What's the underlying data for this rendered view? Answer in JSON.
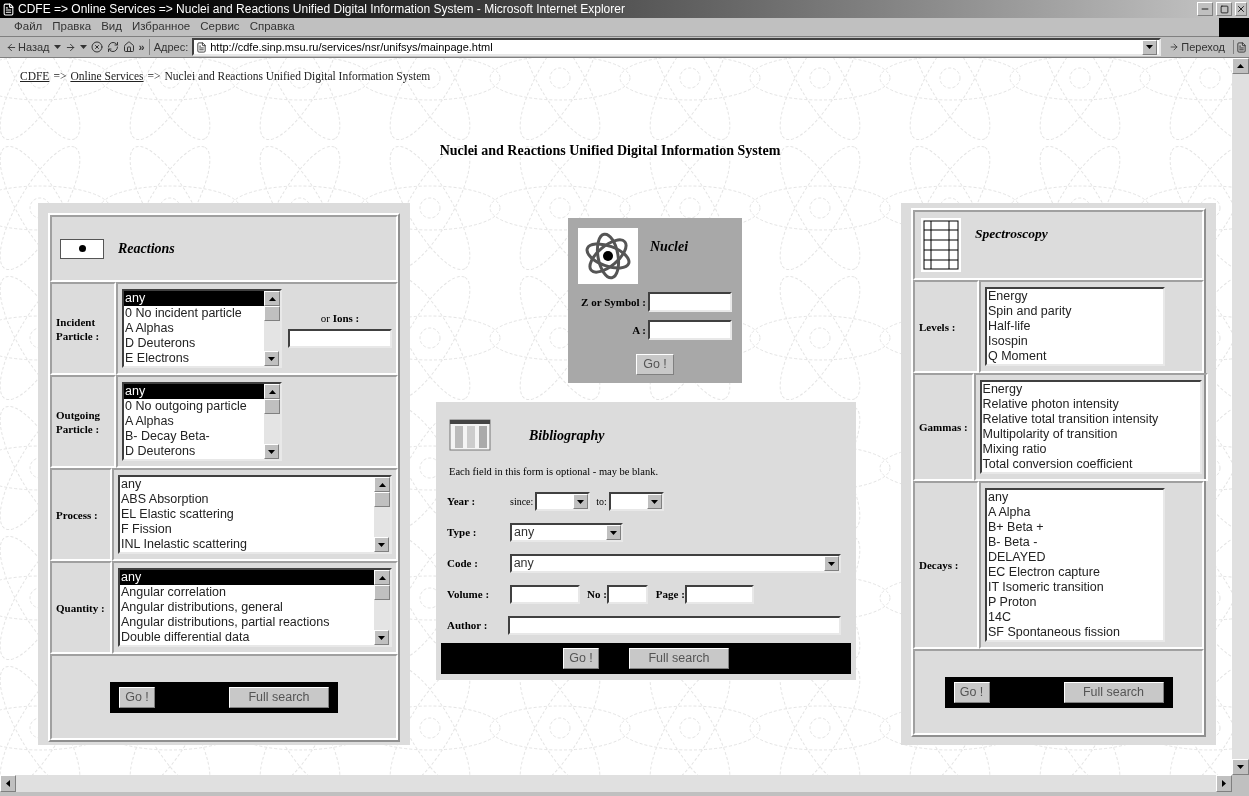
{
  "window": {
    "title": "CDFE => Online Services => Nuclei and Reactions Unified Digital Information System - Microsoft Internet Explorer"
  },
  "menu": [
    "Файл",
    "Правка",
    "Вид",
    "Избранное",
    "Сервис",
    "Справка"
  ],
  "toolbar": {
    "back": "Назад",
    "more": "»",
    "address_label": "Адрес:",
    "url": "http://cdfe.sinp.msu.ru/services/nsr/unifsys/mainpage.html",
    "go": "Переход"
  },
  "breadcrumb": [
    {
      "kind": "link",
      "text": "CDFE"
    },
    {
      "kind": "sep",
      "text": "=>"
    },
    {
      "kind": "link",
      "text": "Online Services"
    },
    {
      "kind": "sep",
      "text": "=>"
    },
    {
      "kind": "text",
      "text": "Nuclei and Reactions Unified Digital Information System"
    }
  ],
  "page_title": "Nuclei and Reactions Unified Digital Information System",
  "reactions": {
    "title": "Reactions",
    "rows": [
      {
        "label": "Incident Particle :",
        "wide": false,
        "scrollable": true,
        "extra": "or **Ions :**",
        "items": [
          {
            "text": "any",
            "selected": true
          },
          {
            "text": "0 No incident particle",
            "selected": false
          },
          {
            "text": "A Alphas",
            "selected": false
          },
          {
            "text": "D Deuterons",
            "selected": false
          },
          {
            "text": "E Electrons",
            "selected": false
          }
        ]
      },
      {
        "label": "Outgoing Particle :",
        "wide": false,
        "scrollable": true,
        "items": [
          {
            "text": "any",
            "selected": true
          },
          {
            "text": "0 No outgoing particle",
            "selected": false
          },
          {
            "text": "A Alphas",
            "selected": false
          },
          {
            "text": "B- Decay Beta-",
            "selected": false
          },
          {
            "text": "D Deuterons",
            "selected": false
          }
        ]
      },
      {
        "label": "Process :",
        "wide": true,
        "scrollable": true,
        "items": [
          {
            "text": "any",
            "selected": false
          },
          {
            "text": "ABS Absorption",
            "selected": false
          },
          {
            "text": "EL Elastic scattering",
            "selected": false
          },
          {
            "text": "F Fission",
            "selected": false
          },
          {
            "text": "INL Inelastic scattering",
            "selected": false
          }
        ]
      },
      {
        "label": "Quantity :",
        "wide": true,
        "scrollable": true,
        "items": [
          {
            "text": "any",
            "selected": true
          },
          {
            "text": "Angular correlation",
            "selected": false
          },
          {
            "text": "Angular distributions, general",
            "selected": false
          },
          {
            "text": "Angular distributions, partial reactions",
            "selected": false
          },
          {
            "text": "Double differential data",
            "selected": false
          }
        ]
      }
    ],
    "buttons": [
      "Go !",
      "Full search"
    ]
  },
  "nuclei": {
    "title": "Nuclei",
    "fields": [
      {
        "label": "Z or Symbol :"
      },
      {
        "label": "A :"
      }
    ],
    "button": "Go !"
  },
  "bibliography": {
    "title": "Bibliography",
    "note": "Each field in this form is optional - may be blank.",
    "year": {
      "label": "Year :",
      "since": "since:",
      "to": "to:"
    },
    "type": {
      "label": "Type :",
      "value": "any"
    },
    "code": {
      "label": "Code :",
      "value": "any"
    },
    "volume": {
      "label": "Volume :"
    },
    "no": {
      "label": "No :"
    },
    "page": {
      "label": "Page :"
    },
    "author": {
      "label": "Author :"
    },
    "buttons": [
      "Go !",
      "Full search"
    ]
  },
  "spectroscopy": {
    "title": "Spectroscopy",
    "rows": [
      {
        "label": "Levels :",
        "wide": false,
        "scrollable": false,
        "items": [
          {
            "text": "Energy",
            "selected": false
          },
          {
            "text": "Spin and parity",
            "selected": false
          },
          {
            "text": "Half-life",
            "selected": false
          },
          {
            "text": "Isospin",
            "selected": false
          },
          {
            "text": "Q Moment",
            "selected": false
          }
        ]
      },
      {
        "label": "Gammas :",
        "wide": true,
        "scrollable": false,
        "items": [
          {
            "text": "Energy",
            "selected": false
          },
          {
            "text": "Relative photon intensity",
            "selected": false
          },
          {
            "text": "Relative total transition intensity",
            "selected": false
          },
          {
            "text": "Multipolarity of transition",
            "selected": false
          },
          {
            "text": "Mixing ratio",
            "selected": false
          },
          {
            "text": "Total conversion coefficient",
            "selected": false
          }
        ]
      },
      {
        "label": "Decays :",
        "wide": false,
        "scrollable": false,
        "items": [
          {
            "text": "any",
            "selected": false
          },
          {
            "text": "A Alpha",
            "selected": false
          },
          {
            "text": "B+ Beta +",
            "selected": false
          },
          {
            "text": "B- Beta -",
            "selected": false
          },
          {
            "text": "DELAYED",
            "selected": false
          },
          {
            "text": "EC Electron capture",
            "selected": false
          },
          {
            "text": "IT Isomeric transition",
            "selected": false
          },
          {
            "text": "P Proton",
            "selected": false
          },
          {
            "text": "14C",
            "selected": false
          },
          {
            "text": "SF Spontaneous fission",
            "selected": false
          }
        ]
      }
    ],
    "buttons": [
      "Go !",
      "Full search"
    ]
  }
}
